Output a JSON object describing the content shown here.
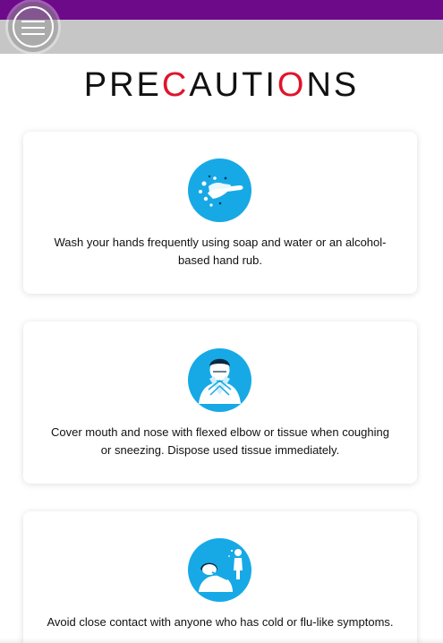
{
  "header": {
    "title_parts": [
      "PRE",
      "C",
      "AUTI",
      "O",
      "NS"
    ],
    "menu_icon": "hamburger-menu-icon"
  },
  "colors": {
    "top_bar": "#6d0a8a",
    "sub_bar": "#c6c6c6",
    "accent_red": "#e0142b",
    "icon_blue": "#17a9e6"
  },
  "precautions": [
    {
      "icon": "hand-washing-icon",
      "text": "Wash your hands frequently using soap and water or an alcohol-based hand rub."
    },
    {
      "icon": "cover-sneeze-icon",
      "text": "Cover mouth and nose with flexed elbow or tissue when coughing or sneezing. Dispose used tissue immediately."
    },
    {
      "icon": "avoid-contact-icon",
      "text": "Avoid close contact with anyone who has cold or flu-like symptoms."
    }
  ]
}
